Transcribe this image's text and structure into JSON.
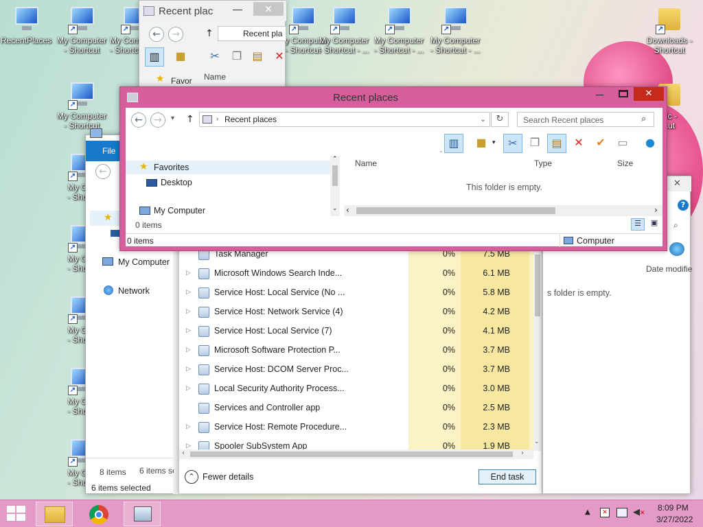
{
  "desktop": {
    "icons": [
      {
        "label": "RecentPlaces"
      },
      {
        "label": "My Computer\n- Shortcut"
      },
      {
        "label": "My Computer\n- Shortcut - ..."
      },
      {
        "label": "My Computer\n- Shortcut"
      },
      {
        "label": "My Computer\n- Shortcut - ..."
      },
      {
        "label": "My Computer\n- Shortcut - ..."
      },
      {
        "label": "My Computer\n- Shortcut - ..."
      },
      {
        "label": "Downloads -\nShortcut"
      },
      {
        "label": "My Computer\n- Shortcut"
      },
      {
        "label": "My Con\n- Shortc"
      },
      {
        "label": "My Con\n- Shortc"
      },
      {
        "label": "My Con\n- Shortc"
      },
      {
        "label": "My Con\n- Shortc"
      },
      {
        "label": "My Con\n- Shortc"
      },
      {
        "label": "sic -\ncut"
      }
    ]
  },
  "back_window": {
    "title": "Recent plac",
    "address": "Recent pla",
    "favorites": "Favor",
    "name_col": "Name"
  },
  "explorer_left": {
    "file_tab": "File",
    "nav": [
      "My Computer",
      "Network"
    ],
    "items_count": "8 items",
    "selected": "6 items selected",
    "items_count2": "6 items se"
  },
  "task_manager": {
    "processes": [
      {
        "name": "Task Manager",
        "cpu": "0%",
        "mem": "7.5 MB",
        "expand": false
      },
      {
        "name": "Microsoft Windows Search Inde...",
        "cpu": "0%",
        "mem": "6.1 MB",
        "expand": true
      },
      {
        "name": "Service Host: Local Service (No ...",
        "cpu": "0%",
        "mem": "5.8 MB",
        "expand": true
      },
      {
        "name": "Service Host: Network Service (4)",
        "cpu": "0%",
        "mem": "4.2 MB",
        "expand": true
      },
      {
        "name": "Service Host: Local Service (7)",
        "cpu": "0%",
        "mem": "4.1 MB",
        "expand": true
      },
      {
        "name": "Microsoft Software Protection P...",
        "cpu": "0%",
        "mem": "3.7 MB",
        "expand": true
      },
      {
        "name": "Service Host: DCOM Server Proc...",
        "cpu": "0%",
        "mem": "3.7 MB",
        "expand": true
      },
      {
        "name": "Local Security Authority Process...",
        "cpu": "0%",
        "mem": "3.0 MB",
        "expand": true
      },
      {
        "name": "Services and Controller app",
        "cpu": "0%",
        "mem": "2.5 MB",
        "expand": false
      },
      {
        "name": "Service Host: Remote Procedure...",
        "cpu": "0%",
        "mem": "2.3 MB",
        "expand": true
      },
      {
        "name": "Spooler SubSystem App",
        "cpu": "0%",
        "mem": "1.9 MB",
        "expand": true
      }
    ],
    "fewer_details": "Fewer details",
    "end_task": "End task"
  },
  "right_window": {
    "empty_text": "s folder is empty.",
    "date_col": "Date modifie"
  },
  "main_window": {
    "title": "Recent places",
    "address": "Recent places",
    "search_placeholder": "Search Recent places",
    "nav_favorites": "Favorites",
    "nav_desktop": "Desktop",
    "nav_computer": "My Computer",
    "col_name": "Name",
    "col_type": "Type",
    "col_size": "Size",
    "empty_text": "This folder is empty.",
    "items_count": "0 items",
    "status_items": "0 items",
    "status_location": "Computer",
    "frame_color": "#d65f9b"
  },
  "taskbar": {
    "time": "8:09 PM",
    "date": "3/27/2022",
    "color": "#e49ac6"
  }
}
